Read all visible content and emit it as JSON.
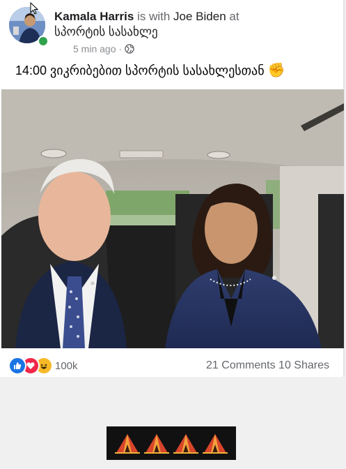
{
  "post": {
    "author": "Kamala Harris",
    "with_text": "is with",
    "tagged": "Joe Biden",
    "at_text": "at",
    "location": "სპორტის სასახლე",
    "time": "5 min ago",
    "separator": "·",
    "privacy_icon": "globe-icon",
    "text": "14:00 ვიკრიბებით სპორტის სასახლესთან",
    "text_emoji": "✊"
  },
  "reactions": {
    "icons": [
      "like-icon",
      "love-icon",
      "haha-icon"
    ],
    "count": "100k"
  },
  "stats": {
    "comments_shares": "21 Comments 10 Shares"
  },
  "banner": {
    "icons": [
      "tent-icon",
      "tent-icon",
      "tent-icon",
      "tent-icon"
    ]
  },
  "colors": {
    "like": "#1b74e4",
    "love": "#f0284a",
    "haha": "#f7b928",
    "online": "#31a24c"
  }
}
